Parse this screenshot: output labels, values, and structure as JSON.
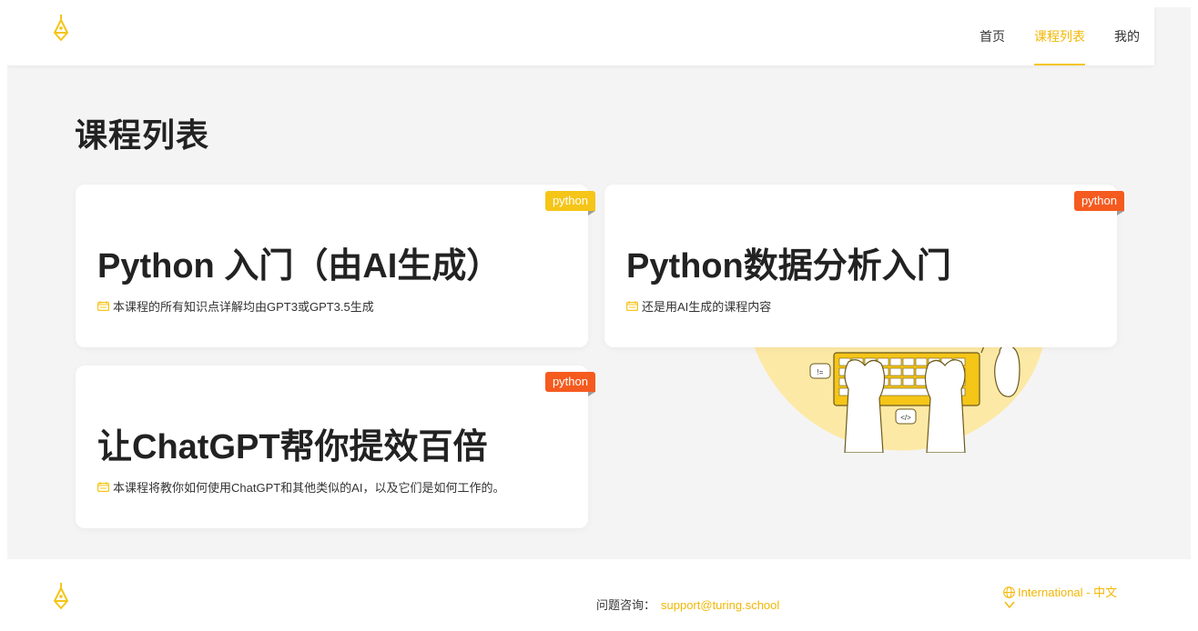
{
  "header": {
    "logo": "pen-nib-logo",
    "nav": [
      {
        "label": "首页",
        "active": false
      },
      {
        "label": "课程列表",
        "active": true
      },
      {
        "label": "我的",
        "active": false
      }
    ]
  },
  "page_title": "课程列表",
  "courses": [
    {
      "title": "Python 入门（由AI生成）",
      "description": "本课程的所有知识点详解均由GPT3或GPT3.5生成",
      "tag": "python",
      "tag_color": "#f5c518"
    },
    {
      "title": "Python数据分析入门",
      "description": "还是用AI生成的课程内容",
      "tag": "python",
      "tag_color": "#f55a1f"
    },
    {
      "title": "让ChatGPT帮你提效百倍",
      "description": "本课程将教你如何使用ChatGPT和其他类似的AI，以及它们是如何工作的。",
      "tag": "python",
      "tag_color": "#f55a1f"
    }
  ],
  "illustration": {
    "bubble_1": "!=",
    "bubble_2": "</>"
  },
  "footer": {
    "contact_label": "问题咨询：",
    "contact_email": "support@turing.school",
    "language": "International - 中文"
  },
  "colors": {
    "accent": "#f5c518",
    "accent_text": "#f2b705",
    "tag_orange": "#f55a1f",
    "background": "#f4f4f4"
  }
}
